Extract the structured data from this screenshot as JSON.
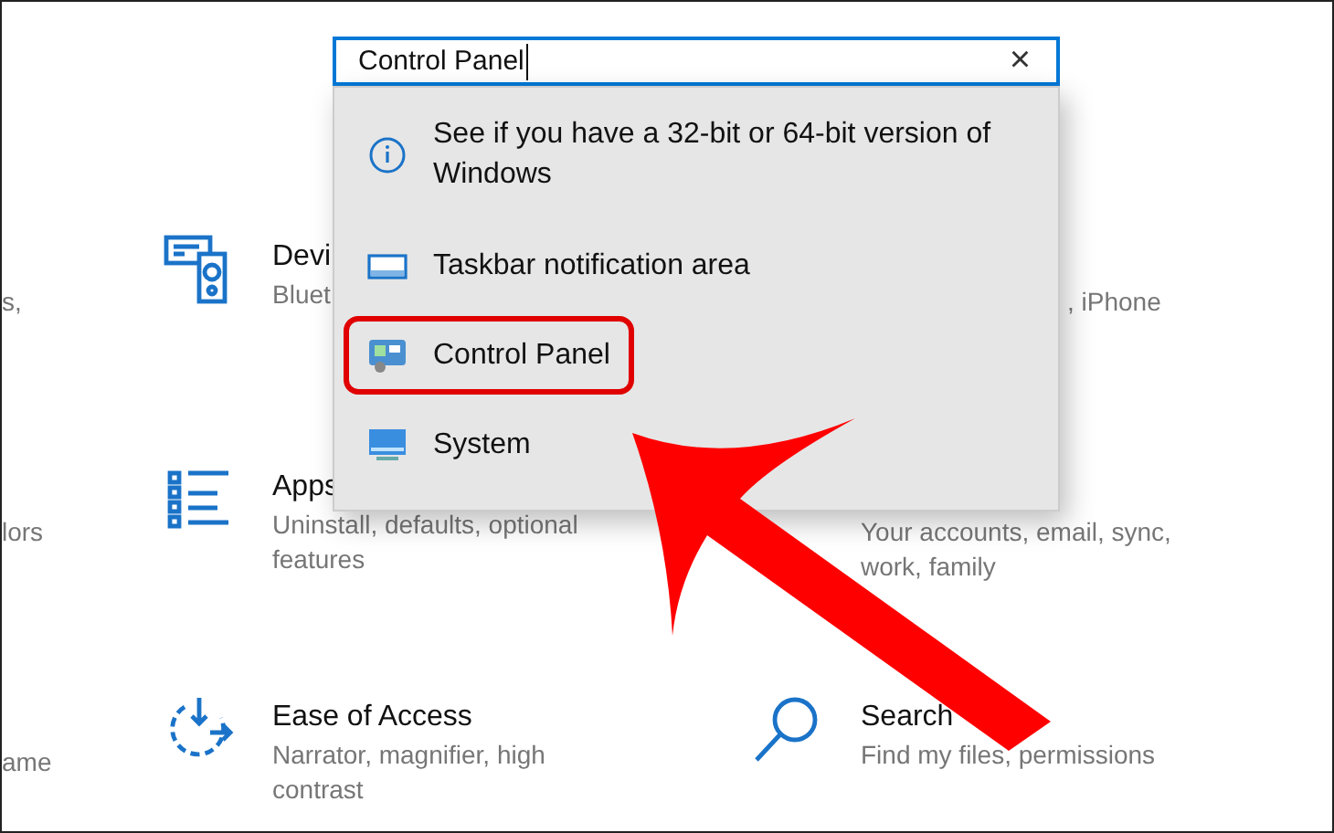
{
  "search": {
    "value": "Control Panel",
    "clear_label": "×"
  },
  "results": [
    {
      "kind": "info",
      "label": "See if you have a 32-bit or 64-bit version of Windows",
      "annotated": false
    },
    {
      "kind": "taskbar",
      "label": "Taskbar notification area",
      "annotated": false
    },
    {
      "kind": "control-panel",
      "label": "Control Panel",
      "annotated": true
    },
    {
      "kind": "system",
      "label": "System",
      "annotated": false
    }
  ],
  "tiles": [
    {
      "kind": "edge",
      "lines": [
        "s,"
      ]
    },
    {
      "kind": "devices",
      "title": "Devi",
      "lines": [
        "Bluet"
      ]
    },
    {
      "kind": "tail",
      "lines": [
        ", iPhone"
      ]
    },
    {
      "kind": "edge",
      "lines": [
        "lors"
      ]
    },
    {
      "kind": "apps",
      "title": "Apps",
      "lines": [
        "Uninstall, defaults, optional",
        "features"
      ]
    },
    {
      "kind": "covered",
      "lines": [
        "Your accounts, email, sync,",
        "work, family"
      ]
    },
    {
      "kind": "edge",
      "lines": [
        "ame"
      ]
    },
    {
      "kind": "ease",
      "title": "Ease of Access",
      "lines": [
        "Narrator, magnifier, high",
        "contrast"
      ]
    },
    {
      "kind": "search",
      "title": "Search",
      "lines": [
        "Find my files, permissions"
      ]
    }
  ],
  "annotation": {
    "kind": "arrow"
  }
}
